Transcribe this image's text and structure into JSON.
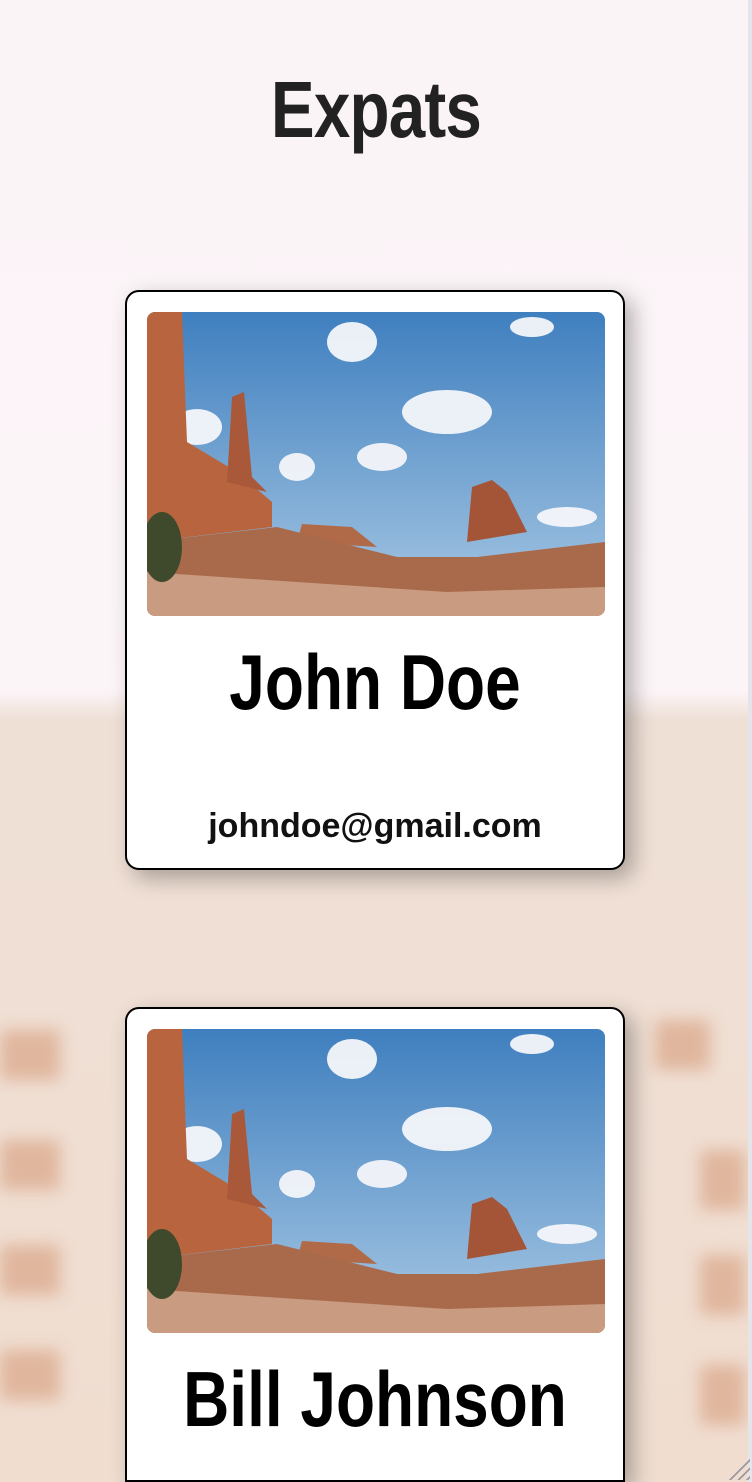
{
  "page": {
    "title": "Expats"
  },
  "cards": [
    {
      "name": "John Doe",
      "email": "johndoe@gmail.com",
      "image": "desert-landscape-photo"
    },
    {
      "name": "Bill Johnson",
      "image": "desert-landscape-photo"
    }
  ]
}
